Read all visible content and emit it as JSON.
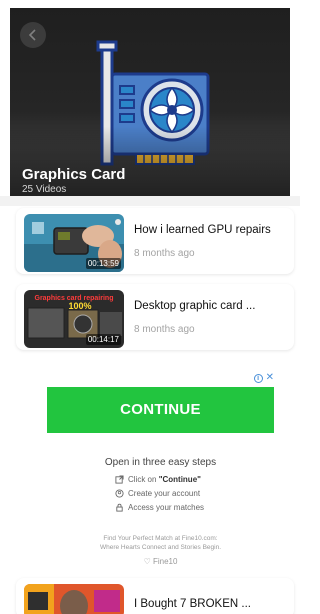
{
  "collection": {
    "title": "Graphics Card",
    "count": "25 Videos"
  },
  "videos": [
    {
      "title": "How i learned GPU repairs",
      "age": "8 months ago",
      "duration": "00:13:59",
      "thumb_text": ""
    },
    {
      "title": "Desktop graphic card ...",
      "age": "8 months ago",
      "duration": "00:14:17",
      "thumb_text": "Graphics card repairing 100%"
    },
    {
      "title": "I Bought 7 BROKEN ...",
      "age": "",
      "duration": "",
      "thumb_text": ""
    }
  ],
  "ad": {
    "button": "CONTINUE",
    "heading": "Open in three easy steps",
    "step1_prefix": "Click on ",
    "step1_bold": "\"Continue\"",
    "step2": "Create your account",
    "step3": "Access your matches",
    "footer_line1": "Find Your Perfect Match at Fine10.com:",
    "footer_line2": "Where Hearts Connect and Stories Begin.",
    "brand": "Fine10"
  },
  "colors": {
    "ad_button": "#22c53f",
    "hero_bg": "#232323",
    "gpu_outline": "#1d3b8c",
    "gpu_fan": "#2a86c9"
  }
}
